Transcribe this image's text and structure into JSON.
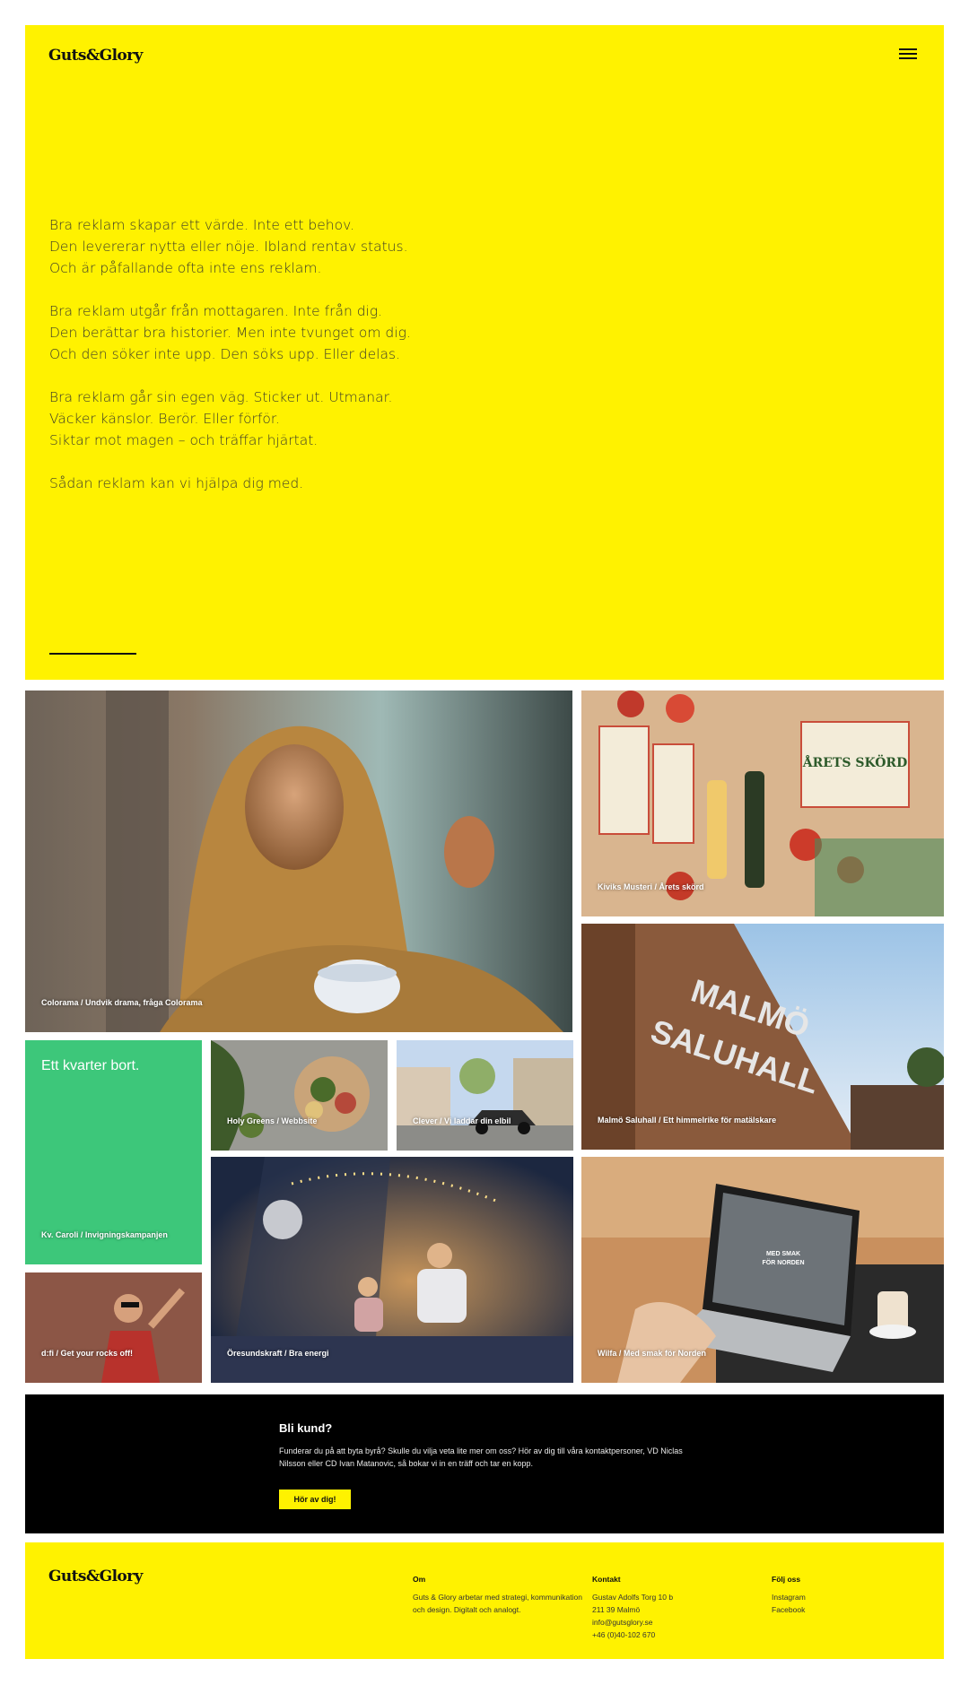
{
  "brand": {
    "logo": "Guts&Glory",
    "accent": "#fff200"
  },
  "header": {
    "menu_icon": "hamburger-menu-icon"
  },
  "manifesto": {
    "p1": [
      "Bra reklam skapar ett värde. Inte ett behov.",
      "Den levererar nytta eller nöje. Ibland rentav status.",
      "Och är påfallande ofta inte ens reklam."
    ],
    "p2": [
      "Bra reklam utgår från mottagaren. Inte från dig.",
      "Den berättar bra historier. Men inte tvunget om dig.",
      "Och den söker inte upp. Den söks upp. Eller delas."
    ],
    "p3": [
      "Bra reklam går sin egen väg. Sticker ut. Utmanar.",
      "Väcker känslor. Berör. Eller förför.",
      "Siktar mot magen – och träffar hjärtat."
    ],
    "p4": [
      "Sådan reklam kan vi hjälpa dig med."
    ]
  },
  "cases": {
    "colorama": "Colorama / Undvik drama, fråga Colorama",
    "kiviks": "Kiviks Musteri / Årets skörd",
    "saluhall": "Malmö Saluhall / Ett himmelrike för matälskare",
    "caroli_heading": "Ett kvarter bort.",
    "caroli": "Kv. Caroli / Invigningskampanjen",
    "holy": "Holy Greens / Webbsite",
    "clever": "Clever / Vi laddar din elbil",
    "dfi": "d:fi / Get your rocks off!",
    "oresund": "Öresundskraft / Bra energi",
    "wilfa": "Wilfa / Med smak för Norden",
    "kiviks_pack_text": "ÅRETS SKÖRD",
    "saluhall_sign": [
      "MALMÖ",
      "SALUHALL"
    ],
    "wilfa_screen": [
      "MED SMAK",
      "FÖR NORDEN"
    ]
  },
  "cta": {
    "title": "Bli kund?",
    "body": "Funderar du på att byta byrå? Skulle du vilja veta lite mer om oss? Hör av dig till våra kontaktpersoner, VD Niclas Nilsson eller CD Ivan Matanovic, så bokar vi in en träff och tar en kopp.",
    "button": "Hör av dig!"
  },
  "footer": {
    "about_title": "Om",
    "about_text": "Guts & Glory arbetar med strategi, kommunikation och design. Digitalt och analogt.",
    "contact_title": "Kontakt",
    "contact": [
      "Gustav Adolfs Torg 10 b",
      "211 39 Malmö",
      "info@gutsglory.se",
      "+46 (0)40-102 670"
    ],
    "follow_title": "Följ oss",
    "social": [
      "Instagram",
      "Facebook"
    ]
  }
}
